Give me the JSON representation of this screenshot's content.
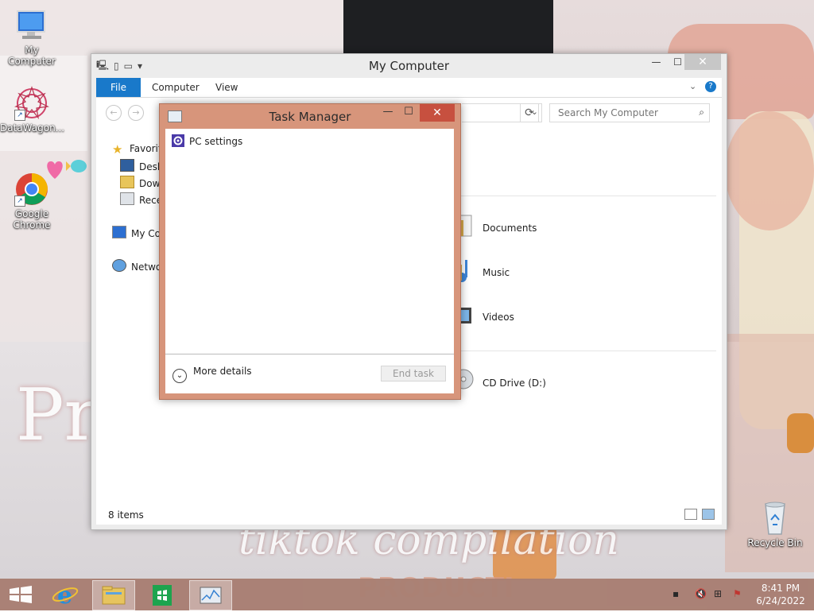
{
  "desktop": {
    "icons": [
      {
        "label": "My Computer"
      },
      {
        "label": "DataWagon..."
      },
      {
        "label": "Google Chrome"
      },
      {
        "label": "Recycle Bin"
      }
    ]
  },
  "explorer": {
    "title": "My Computer",
    "tabs": [
      "File",
      "Computer",
      "View"
    ],
    "search_placeholder": "Search My Computer",
    "nav": {
      "favorites": "Favorites",
      "desktop": "Desktop",
      "downloads": "Downloads",
      "recent": "Recent places",
      "my_computer": "My Computer",
      "network": "Network"
    },
    "libraries": [
      "Documents",
      "Music",
      "Videos"
    ],
    "drive": "CD Drive (D:)",
    "status_count": "8 items"
  },
  "taskmanager": {
    "title": "Task Manager",
    "apps": [
      "PC settings"
    ],
    "more_details": "More details",
    "end_task": "End task"
  },
  "taskbar": {
    "time": "8:41 PM",
    "date": "6/24/2022"
  },
  "colors": {
    "taskmanager_frame": "#d7957b",
    "close_button": "#c7503f",
    "file_tab": "#1979ca",
    "taskbar": "#a97f73"
  }
}
